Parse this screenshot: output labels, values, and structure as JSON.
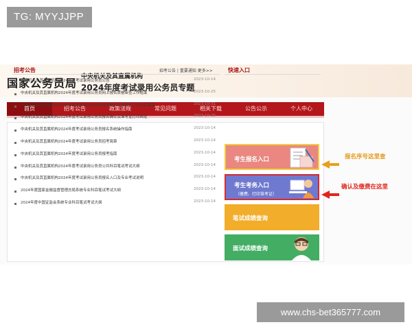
{
  "watermark": {
    "tag": "TG: MYYJJPP",
    "url": "www.chs-bet365777.com"
  },
  "header": {
    "site_title": "国家公务员局",
    "subtitle_org": "中央机关及其直属机构",
    "subtitle_topic": "2024年度考试录用公务员专题"
  },
  "nav": {
    "items": [
      "首页",
      "招考公告",
      "政策法规",
      "常见问题",
      "相关下载",
      "公告公示",
      "个人中心"
    ],
    "active_index": 0
  },
  "notices": {
    "heading": "招考公告",
    "header_links": "招考公告 | 重要通知  更多>>",
    "rows": [
      {
        "title": "中央机关及其直属机构2024年度考试录用公务员公告",
        "date": "2023-10-14"
      },
      {
        "title": "中央机关及其直属机构2024年度考试录用公务员网上报名资格审查工作结束",
        "date": "2023-10-25"
      },
      {
        "title": "中央机关及其直属机构2024年度考试录用公务员报名确认及准考证打印有关事项",
        "date": "2023-10-31"
      },
      {
        "title": "中央机关及其直属机构2024年度考试录用公务员报名确认及准考证打印网址",
        "date": "2023-10-25"
      },
      {
        "title": "中央机关及其直属机构2024年度考试录用公务员报名系统操作指南",
        "date": "2023-10-14"
      },
      {
        "title": "中央机关及其直属机构2024年度考试录用公务员招考简章",
        "date": "2023-10-14"
      },
      {
        "title": "中央机关及其直属机构2024年度考试录用公务员报考指南",
        "date": "2023-10-14"
      },
      {
        "title": "中央机关及其直属机构2024年度考试录用公务员公共科目笔试考试大纲",
        "date": "2023-10-14"
      },
      {
        "title": "中央机关及其直属机构2024年度考试录用公务员报名入口及专业考试说明",
        "date": "2023-10-14"
      },
      {
        "title": "2024年度国家金融监督管理总局系统专业科目笔试考试大纲",
        "date": "2023-10-14"
      },
      {
        "title": "2024年度中国证监会系统专业科目笔试考试大纲",
        "date": "2023-10-14"
      }
    ]
  },
  "quick_entry": {
    "heading": "快速入口",
    "registration": "考生报名入口",
    "exam_entry": "考生考务入口",
    "exam_entry_sub": "（缴费、打印准考证）",
    "written_score": "笔试成绩查询",
    "interview_score": "面试成绩查询"
  },
  "annotations": {
    "serial_number": "报名序号这里查",
    "confirm_pay": "确认及缴费在这里"
  },
  "colors": {
    "brand_red": "#b3171b",
    "reg_card": "#e98780",
    "exam_card": "#6f79cf",
    "written_card": "#f2ad2a",
    "interview_card": "#43ad63",
    "annotation_red": "#e0261e",
    "annotation_yellow": "#e59a1e"
  },
  "icons": [
    "document-form-icon",
    "exam-candidate-icon",
    "doctor-avatar-icon",
    "arrow-left-icon"
  ]
}
